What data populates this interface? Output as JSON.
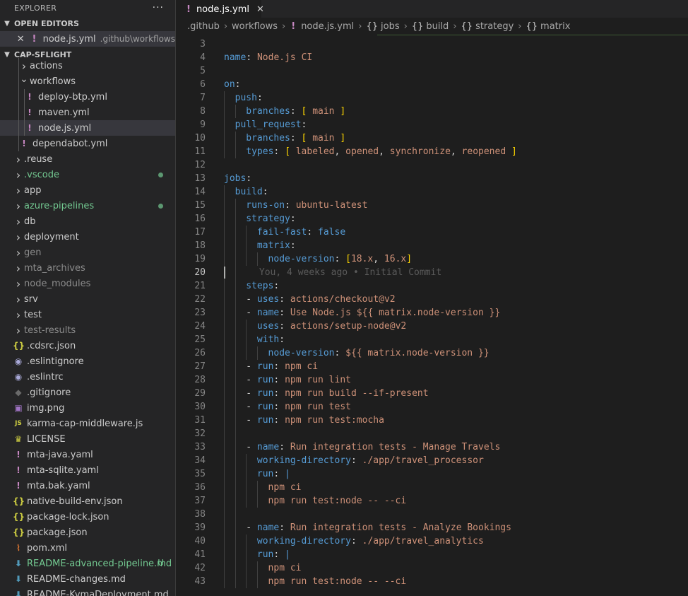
{
  "sidebar": {
    "title": "EXPLORER",
    "more": "···",
    "open_editors": {
      "label": "OPEN EDITORS",
      "item": {
        "name": "node.js.yml",
        "path": ".github\\workflows"
      }
    },
    "project": {
      "label": "CAP-SFLIGHT",
      "items": [
        {
          "label": "actions",
          "kind": "folder-closed",
          "depth": 1
        },
        {
          "label": "workflows",
          "kind": "folder-open",
          "depth": 1
        },
        {
          "label": "deploy-btp.yml",
          "kind": "yaml",
          "depth": 2
        },
        {
          "label": "maven.yml",
          "kind": "yaml",
          "depth": 2
        },
        {
          "label": "node.js.yml",
          "kind": "yaml",
          "depth": 2,
          "selected": true
        },
        {
          "label": "dependabot.yml",
          "kind": "yaml",
          "depth": 1
        },
        {
          "label": ".reuse",
          "kind": "folder-closed",
          "depth": 0
        },
        {
          "label": ".vscode",
          "kind": "folder-closed",
          "depth": 0,
          "color": "green",
          "dot": true
        },
        {
          "label": "app",
          "kind": "folder-closed",
          "depth": 0
        },
        {
          "label": "azure-pipelines",
          "kind": "folder-closed",
          "depth": 0,
          "color": "green",
          "dot": true
        },
        {
          "label": "db",
          "kind": "folder-closed",
          "depth": 0
        },
        {
          "label": "deployment",
          "kind": "folder-closed",
          "depth": 0
        },
        {
          "label": "gen",
          "kind": "folder-closed",
          "depth": 0,
          "color": "dim"
        },
        {
          "label": "mta_archives",
          "kind": "folder-closed",
          "depth": 0,
          "color": "dim"
        },
        {
          "label": "node_modules",
          "kind": "folder-closed",
          "depth": 0,
          "color": "dim"
        },
        {
          "label": "srv",
          "kind": "folder-closed",
          "depth": 0
        },
        {
          "label": "test",
          "kind": "folder-closed",
          "depth": 0
        },
        {
          "label": "test-results",
          "kind": "folder-closed",
          "depth": 0,
          "color": "dim"
        },
        {
          "label": ".cdsrc.json",
          "kind": "json",
          "depth": 0
        },
        {
          "label": ".eslintignore",
          "kind": "eslint",
          "depth": 0
        },
        {
          "label": ".eslintrc",
          "kind": "eslint",
          "depth": 0
        },
        {
          "label": ".gitignore",
          "kind": "git",
          "depth": 0
        },
        {
          "label": "img.png",
          "kind": "image",
          "depth": 0
        },
        {
          "label": "karma-cap-middleware.js",
          "kind": "js",
          "depth": 0
        },
        {
          "label": "LICENSE",
          "kind": "license",
          "depth": 0
        },
        {
          "label": "mta-java.yaml",
          "kind": "yaml",
          "depth": 0
        },
        {
          "label": "mta-sqlite.yaml",
          "kind": "yaml",
          "depth": 0
        },
        {
          "label": "mta.bak.yaml",
          "kind": "yaml",
          "depth": 0
        },
        {
          "label": "native-build-env.json",
          "kind": "json",
          "depth": 0
        },
        {
          "label": "package-lock.json",
          "kind": "json",
          "depth": 0
        },
        {
          "label": "package.json",
          "kind": "json",
          "depth": 0
        },
        {
          "label": "pom.xml",
          "kind": "xml",
          "depth": 0
        },
        {
          "label": "README-advanced-pipeline.md",
          "kind": "markdown",
          "depth": 0,
          "color": "green",
          "badge": "U"
        },
        {
          "label": "README-changes.md",
          "kind": "markdown",
          "depth": 0
        },
        {
          "label": "README-KymaDeployment.md",
          "kind": "markdown",
          "depth": 0
        }
      ]
    }
  },
  "tabs": [
    {
      "label": "node.js.yml",
      "close": "✕"
    }
  ],
  "breadcrumb": [
    {
      "label": ".github",
      "icon": ""
    },
    {
      "label": "workflows",
      "icon": ""
    },
    {
      "label": "node.js.yml",
      "icon": "!"
    },
    {
      "label": "jobs",
      "icon": "{}"
    },
    {
      "label": "build",
      "icon": "{}"
    },
    {
      "label": "strategy",
      "icon": "{}"
    },
    {
      "label": "matrix",
      "icon": "{}"
    }
  ],
  "editor": {
    "current_line": 20,
    "blame": "You, 4 weeks ago • Initial Commit",
    "lines": [
      {
        "n": 3,
        "indent": 0,
        "tokens": []
      },
      {
        "n": 4,
        "indent": 0,
        "tokens": [
          [
            "k",
            "name"
          ],
          [
            "p",
            ": "
          ],
          [
            "s",
            "Node.js CI"
          ]
        ]
      },
      {
        "n": 5,
        "indent": 0,
        "tokens": []
      },
      {
        "n": 6,
        "indent": 0,
        "tokens": [
          [
            "k",
            "on"
          ],
          [
            "p",
            ":"
          ]
        ]
      },
      {
        "n": 7,
        "indent": 1,
        "tokens": [
          [
            "k",
            "push"
          ],
          [
            "p",
            ":"
          ]
        ]
      },
      {
        "n": 8,
        "indent": 2,
        "tokens": [
          [
            "k",
            "branches"
          ],
          [
            "p",
            ": "
          ],
          [
            "br",
            "["
          ],
          [
            "s",
            " main "
          ],
          [
            "br",
            "]"
          ]
        ]
      },
      {
        "n": 9,
        "indent": 1,
        "tokens": [
          [
            "k",
            "pull_request"
          ],
          [
            "p",
            ":"
          ]
        ]
      },
      {
        "n": 10,
        "indent": 2,
        "tokens": [
          [
            "k",
            "branches"
          ],
          [
            "p",
            ": "
          ],
          [
            "br",
            "["
          ],
          [
            "s",
            " main "
          ],
          [
            "br",
            "]"
          ]
        ]
      },
      {
        "n": 11,
        "indent": 2,
        "tokens": [
          [
            "k",
            "types"
          ],
          [
            "p",
            ": "
          ],
          [
            "br",
            "["
          ],
          [
            "s",
            " labeled"
          ],
          [
            "p",
            ", "
          ],
          [
            "s",
            "opened"
          ],
          [
            "p",
            ", "
          ],
          [
            "s",
            "synchronize"
          ],
          [
            "p",
            ", "
          ],
          [
            "s",
            "reopened "
          ],
          [
            "br",
            "]"
          ]
        ]
      },
      {
        "n": 12,
        "indent": 0,
        "tokens": []
      },
      {
        "n": 13,
        "indent": 0,
        "tokens": [
          [
            "k",
            "jobs"
          ],
          [
            "p",
            ":"
          ]
        ]
      },
      {
        "n": 14,
        "indent": 1,
        "tokens": [
          [
            "k",
            "build"
          ],
          [
            "p",
            ":"
          ]
        ]
      },
      {
        "n": 15,
        "indent": 2,
        "tokens": [
          [
            "k",
            "runs-on"
          ],
          [
            "p",
            ": "
          ],
          [
            "s",
            "ubuntu-latest"
          ]
        ]
      },
      {
        "n": 16,
        "indent": 2,
        "tokens": [
          [
            "k",
            "strategy"
          ],
          [
            "p",
            ":"
          ]
        ]
      },
      {
        "n": 17,
        "indent": 3,
        "tokens": [
          [
            "k",
            "fail-fast"
          ],
          [
            "p",
            ": "
          ],
          [
            "b",
            "false"
          ]
        ]
      },
      {
        "n": 18,
        "indent": 3,
        "tokens": [
          [
            "k",
            "matrix"
          ],
          [
            "p",
            ":"
          ]
        ]
      },
      {
        "n": 19,
        "indent": 4,
        "tokens": [
          [
            "k",
            "node-version"
          ],
          [
            "p",
            ": "
          ],
          [
            "br",
            "["
          ],
          [
            "s",
            "18.x"
          ],
          [
            "p",
            ", "
          ],
          [
            "s",
            "16.x"
          ],
          [
            "br",
            "]"
          ]
        ]
      },
      {
        "n": 20,
        "indent": 0,
        "tokens": [],
        "blame": true
      },
      {
        "n": 21,
        "indent": 2,
        "tokens": [
          [
            "k",
            "steps"
          ],
          [
            "p",
            ":"
          ]
        ]
      },
      {
        "n": 22,
        "indent": 2,
        "tokens": [
          [
            "p",
            "- "
          ],
          [
            "k",
            "uses"
          ],
          [
            "p",
            ": "
          ],
          [
            "s",
            "actions/checkout@v2"
          ]
        ]
      },
      {
        "n": 23,
        "indent": 2,
        "tokens": [
          [
            "p",
            "- "
          ],
          [
            "k",
            "name"
          ],
          [
            "p",
            ": "
          ],
          [
            "s",
            "Use Node.js ${{ matrix.node-version }}"
          ]
        ]
      },
      {
        "n": 24,
        "indent": 3,
        "tokens": [
          [
            "k",
            "uses"
          ],
          [
            "p",
            ": "
          ],
          [
            "s",
            "actions/setup-node@v2"
          ]
        ]
      },
      {
        "n": 25,
        "indent": 3,
        "tokens": [
          [
            "k",
            "with"
          ],
          [
            "p",
            ":"
          ]
        ]
      },
      {
        "n": 26,
        "indent": 4,
        "tokens": [
          [
            "k",
            "node-version"
          ],
          [
            "p",
            ": "
          ],
          [
            "s",
            "${{ matrix.node-version }}"
          ]
        ]
      },
      {
        "n": 27,
        "indent": 2,
        "tokens": [
          [
            "p",
            "- "
          ],
          [
            "k",
            "run"
          ],
          [
            "p",
            ": "
          ],
          [
            "s",
            "npm ci"
          ]
        ]
      },
      {
        "n": 28,
        "indent": 2,
        "tokens": [
          [
            "p",
            "- "
          ],
          [
            "k",
            "run"
          ],
          [
            "p",
            ": "
          ],
          [
            "s",
            "npm run lint"
          ]
        ]
      },
      {
        "n": 29,
        "indent": 2,
        "tokens": [
          [
            "p",
            "- "
          ],
          [
            "k",
            "run"
          ],
          [
            "p",
            ": "
          ],
          [
            "s",
            "npm run build --if-present"
          ]
        ]
      },
      {
        "n": 30,
        "indent": 2,
        "tokens": [
          [
            "p",
            "- "
          ],
          [
            "k",
            "run"
          ],
          [
            "p",
            ": "
          ],
          [
            "s",
            "npm run test"
          ]
        ]
      },
      {
        "n": 31,
        "indent": 2,
        "tokens": [
          [
            "p",
            "- "
          ],
          [
            "k",
            "run"
          ],
          [
            "p",
            ": "
          ],
          [
            "s",
            "npm run test:mocha"
          ]
        ]
      },
      {
        "n": 32,
        "indent": 2,
        "tokens": []
      },
      {
        "n": 33,
        "indent": 2,
        "tokens": [
          [
            "p",
            "- "
          ],
          [
            "k",
            "name"
          ],
          [
            "p",
            ": "
          ],
          [
            "s",
            "Run integration tests - Manage Travels"
          ]
        ]
      },
      {
        "n": 34,
        "indent": 3,
        "tokens": [
          [
            "k",
            "working-directory"
          ],
          [
            "p",
            ": "
          ],
          [
            "s",
            "./app/travel_processor"
          ]
        ]
      },
      {
        "n": 35,
        "indent": 3,
        "tokens": [
          [
            "k",
            "run"
          ],
          [
            "p",
            ": "
          ],
          [
            "b",
            "|"
          ]
        ]
      },
      {
        "n": 36,
        "indent": 4,
        "tokens": [
          [
            "s",
            "npm ci"
          ]
        ]
      },
      {
        "n": 37,
        "indent": 4,
        "tokens": [
          [
            "s",
            "npm run test:node -- --ci"
          ]
        ]
      },
      {
        "n": 38,
        "indent": 2,
        "tokens": []
      },
      {
        "n": 39,
        "indent": 2,
        "tokens": [
          [
            "p",
            "- "
          ],
          [
            "k",
            "name"
          ],
          [
            "p",
            ": "
          ],
          [
            "s",
            "Run integration tests - Analyze Bookings"
          ]
        ]
      },
      {
        "n": 40,
        "indent": 3,
        "tokens": [
          [
            "k",
            "working-directory"
          ],
          [
            "p",
            ": "
          ],
          [
            "s",
            "./app/travel_analytics"
          ]
        ]
      },
      {
        "n": 41,
        "indent": 3,
        "tokens": [
          [
            "k",
            "run"
          ],
          [
            "p",
            ": "
          ],
          [
            "b",
            "|"
          ]
        ]
      },
      {
        "n": 42,
        "indent": 4,
        "tokens": [
          [
            "s",
            "npm ci"
          ]
        ]
      },
      {
        "n": 43,
        "indent": 4,
        "tokens": [
          [
            "s",
            "npm run test:node -- --ci"
          ]
        ]
      }
    ]
  }
}
